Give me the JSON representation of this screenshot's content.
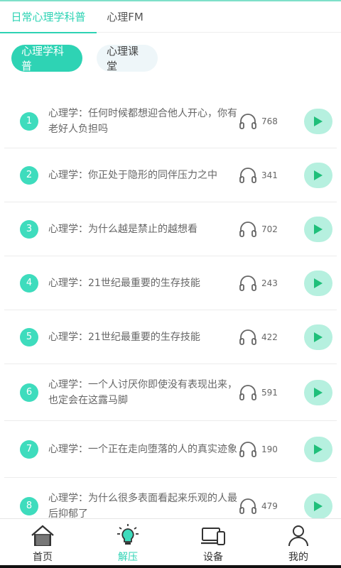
{
  "top_tabs": [
    {
      "label": "日常心理学科普",
      "active": true
    },
    {
      "label": "心理FM",
      "active": false
    }
  ],
  "pills": [
    {
      "label": "心理学科普",
      "active": true
    },
    {
      "label": "心理课堂",
      "active": false
    }
  ],
  "items": [
    {
      "num": "1",
      "title": "心理学：任何时候都想迎合他人开心，你有老好人负担吗",
      "count": "768"
    },
    {
      "num": "2",
      "title": "心理学：你正处于隐形的同伴压力之中",
      "count": "341"
    },
    {
      "num": "3",
      "title": "心理学：为什么越是禁止的越想看",
      "count": "702"
    },
    {
      "num": "4",
      "title": "心理学：21世纪最重要的生存技能",
      "count": "243"
    },
    {
      "num": "5",
      "title": "心理学：21世纪最重要的生存技能",
      "count": "422"
    },
    {
      "num": "6",
      "title": "心理学：一个人讨厌你即使没有表现出来，也定会在这露马脚",
      "count": "591"
    },
    {
      "num": "7",
      "title": "心理学：一个正在走向堕落的人的真实迹象",
      "count": "190"
    },
    {
      "num": "8",
      "title": "心理学：为什么很多表面看起来乐观的人最后抑郁了",
      "count": "479"
    }
  ],
  "nav": [
    {
      "label": "首页",
      "icon": "home-icon",
      "active": false
    },
    {
      "label": "解压",
      "icon": "lightbulb-icon",
      "active": true
    },
    {
      "label": "设备",
      "icon": "devices-icon",
      "active": false
    },
    {
      "label": "我的",
      "icon": "user-icon",
      "active": false
    }
  ],
  "colors": {
    "accent": "#2ed3b4",
    "play_bg": "#b6f0df",
    "pill_inactive": "#eef6f9"
  }
}
